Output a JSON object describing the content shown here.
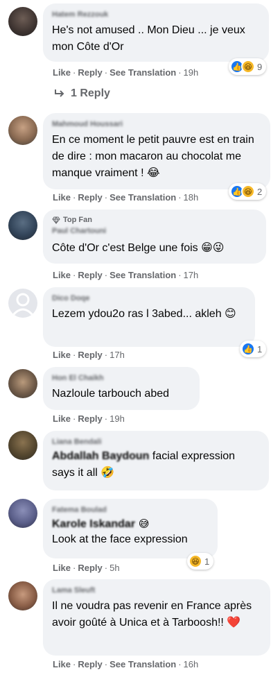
{
  "action_labels": {
    "like": "Like",
    "reply": "Reply",
    "see_translation": "See Translation",
    "sep": "·"
  },
  "comments": [
    {
      "author": "Hatem Rezzouk",
      "text": "He's not amused .. Mon Dieu ... je veux mon Côte d'Or",
      "time": "19h",
      "reactions": [
        "like",
        "haha"
      ],
      "reaction_count": "9",
      "has_translation": true
    },
    {
      "author": "Mahmoud Houssari",
      "text": "En ce moment le petit pauvre est en train de dire : mon macaron au chocolat me manque vraiment ! 😂",
      "time": "18h",
      "reactions": [
        "like",
        "haha"
      ],
      "reaction_count": "2",
      "has_translation": true
    },
    {
      "badge": "Top Fan",
      "author": "Paul Chartouni",
      "text": "Côte d'Or c'est Belge une fois 😁😜",
      "time": "17h",
      "has_translation": true
    },
    {
      "author": "Dico Doqe",
      "text": "Lezem ydou2o ras l 3abed... akleh 😊",
      "time": "17h",
      "reactions": [
        "like"
      ],
      "reaction_count": "1"
    },
    {
      "author": "Hon El Chaikh",
      "text": "Nazloule tarbouch abed",
      "time": "19h"
    },
    {
      "author": "Liana Bendali",
      "mention": "Abdallah Baydoun",
      "text": " facial expression says it all 🤣",
      "time": ""
    },
    {
      "author": "Fatema Boulad",
      "mention": "Karole Iskandar",
      "text_mention_tail": " 😅",
      "text": "Look at the face expression",
      "time": "5h",
      "reactions": [
        "haha"
      ],
      "reaction_count": "1"
    },
    {
      "author": "Lama Sleuft",
      "text": "Il ne voudra pas revenir en France après avoir goûté à Unica et à Tarboosh!! ❤️",
      "time": "16h",
      "has_translation": true
    }
  ],
  "replies_link": {
    "label": "1 Reply"
  },
  "colors": {
    "bubble": "#f0f2f5",
    "meta": "#65676b",
    "like_blue": "#1877f2",
    "haha_yellow": "#f7b928"
  },
  "icons": {
    "reply_arrow": "reply-arrow-icon",
    "top_fan": "diamond-icon",
    "like": "like-reaction-icon",
    "haha": "haha-reaction-icon"
  }
}
